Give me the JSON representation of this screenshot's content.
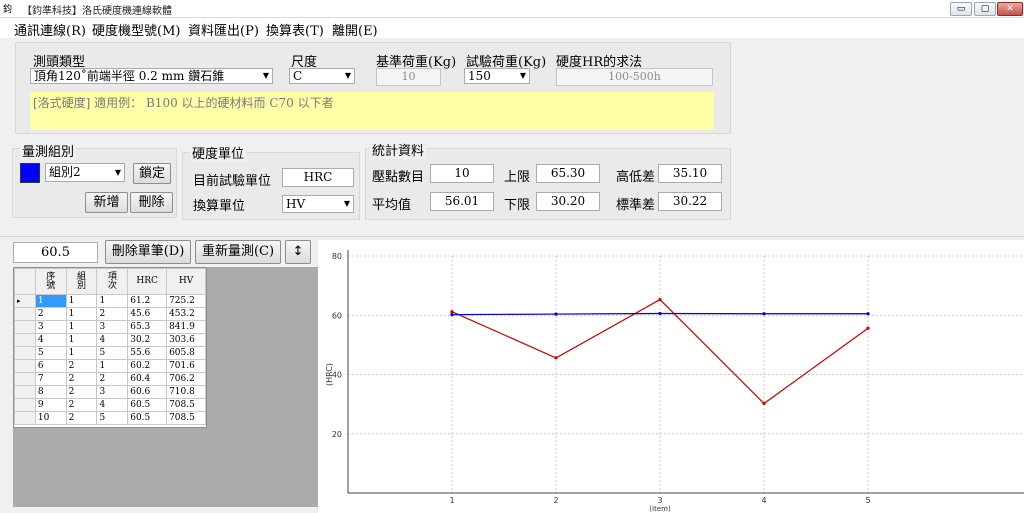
{
  "window": {
    "title": "【鈞準科技】洛氏硬度機連線軟體",
    "app_icon": "鈞",
    "minimize": "▭",
    "maximize": "▢",
    "close": "✕"
  },
  "menu": [
    "通訊連線(R)",
    "硬度機型號(M)",
    "資料匯出(P)",
    "換算表(T)",
    "離開(E)"
  ],
  "top": {
    "probe_type_label": "測頭類型",
    "probe_type_value": "頂角120˚前端半徑 0.2 mm 鑽石錐",
    "scale_label": "尺度",
    "scale_value": "C",
    "base_load_label": "基準荷重(Kg)",
    "base_load_value": "10",
    "test_load_label": "試驗荷重(Kg)",
    "test_load_value": "150",
    "hr_method_label": "硬度HR的求法",
    "hr_method_value": "100-500h",
    "note": "[洛式硬度] 適用例： B100 以上的硬材料而 C70 以下者"
  },
  "group": {
    "title": "量測組別",
    "color": "#0000ff",
    "select_value": "組別2",
    "lock_label": "鎖定",
    "add_label": "新增",
    "delete_label": "刪除"
  },
  "unit": {
    "title": "硬度單位",
    "current_label": "目前試驗單位",
    "current_value": "HRC",
    "convert_label": "換算單位",
    "convert_value": "HV"
  },
  "stats": {
    "title": "統計資料",
    "count_label": "壓點數目",
    "count_value": "10",
    "upper_label": "上限",
    "upper_value": "65.30",
    "range_label": "高低差",
    "range_value": "35.10",
    "mean_label": "平均值",
    "mean_value": "56.01",
    "lower_label": "下限",
    "lower_value": "30.20",
    "std_label": "標準差",
    "std_value": "30.22"
  },
  "toolbar": {
    "reading": "60.5",
    "delete_single_label": "刪除單筆(D)",
    "remeasure_label": "重新量測(C)",
    "sort_icon": "↕"
  },
  "table": {
    "headers": [
      "序\n號",
      "組\n別",
      "項\n次",
      "HRC",
      "HV"
    ],
    "rows": [
      [
        "1",
        "1",
        "1",
        "61.2",
        "725.2"
      ],
      [
        "2",
        "1",
        "2",
        "45.6",
        "453.2"
      ],
      [
        "3",
        "1",
        "3",
        "65.3",
        "841.9"
      ],
      [
        "4",
        "1",
        "4",
        "30.2",
        "303.6"
      ],
      [
        "5",
        "1",
        "5",
        "55.6",
        "605.8"
      ],
      [
        "6",
        "2",
        "1",
        "60.2",
        "701.6"
      ],
      [
        "7",
        "2",
        "2",
        "60.4",
        "706.2"
      ],
      [
        "8",
        "2",
        "3",
        "60.6",
        "710.8"
      ],
      [
        "9",
        "2",
        "4",
        "60.5",
        "708.5"
      ],
      [
        "10",
        "2",
        "5",
        "60.5",
        "708.5"
      ]
    ],
    "selected_row": 0,
    "row_marker": "▸"
  },
  "chart_data": {
    "type": "line",
    "x": [
      1,
      2,
      3,
      4,
      5
    ],
    "ylabel": "(HRC)",
    "xlabel": "(Item)",
    "ylim": [
      0,
      80
    ],
    "xlim": [
      0,
      6.5
    ],
    "yticks": [
      20,
      40,
      60,
      80
    ],
    "grid": true,
    "series": [
      {
        "values": [
          61.2,
          45.6,
          65.3,
          30.2,
          55.6
        ],
        "color": "#cc0000"
      },
      {
        "values": [
          60.2,
          60.4,
          60.6,
          60.5,
          60.5
        ],
        "color": "#0000cc"
      }
    ]
  }
}
